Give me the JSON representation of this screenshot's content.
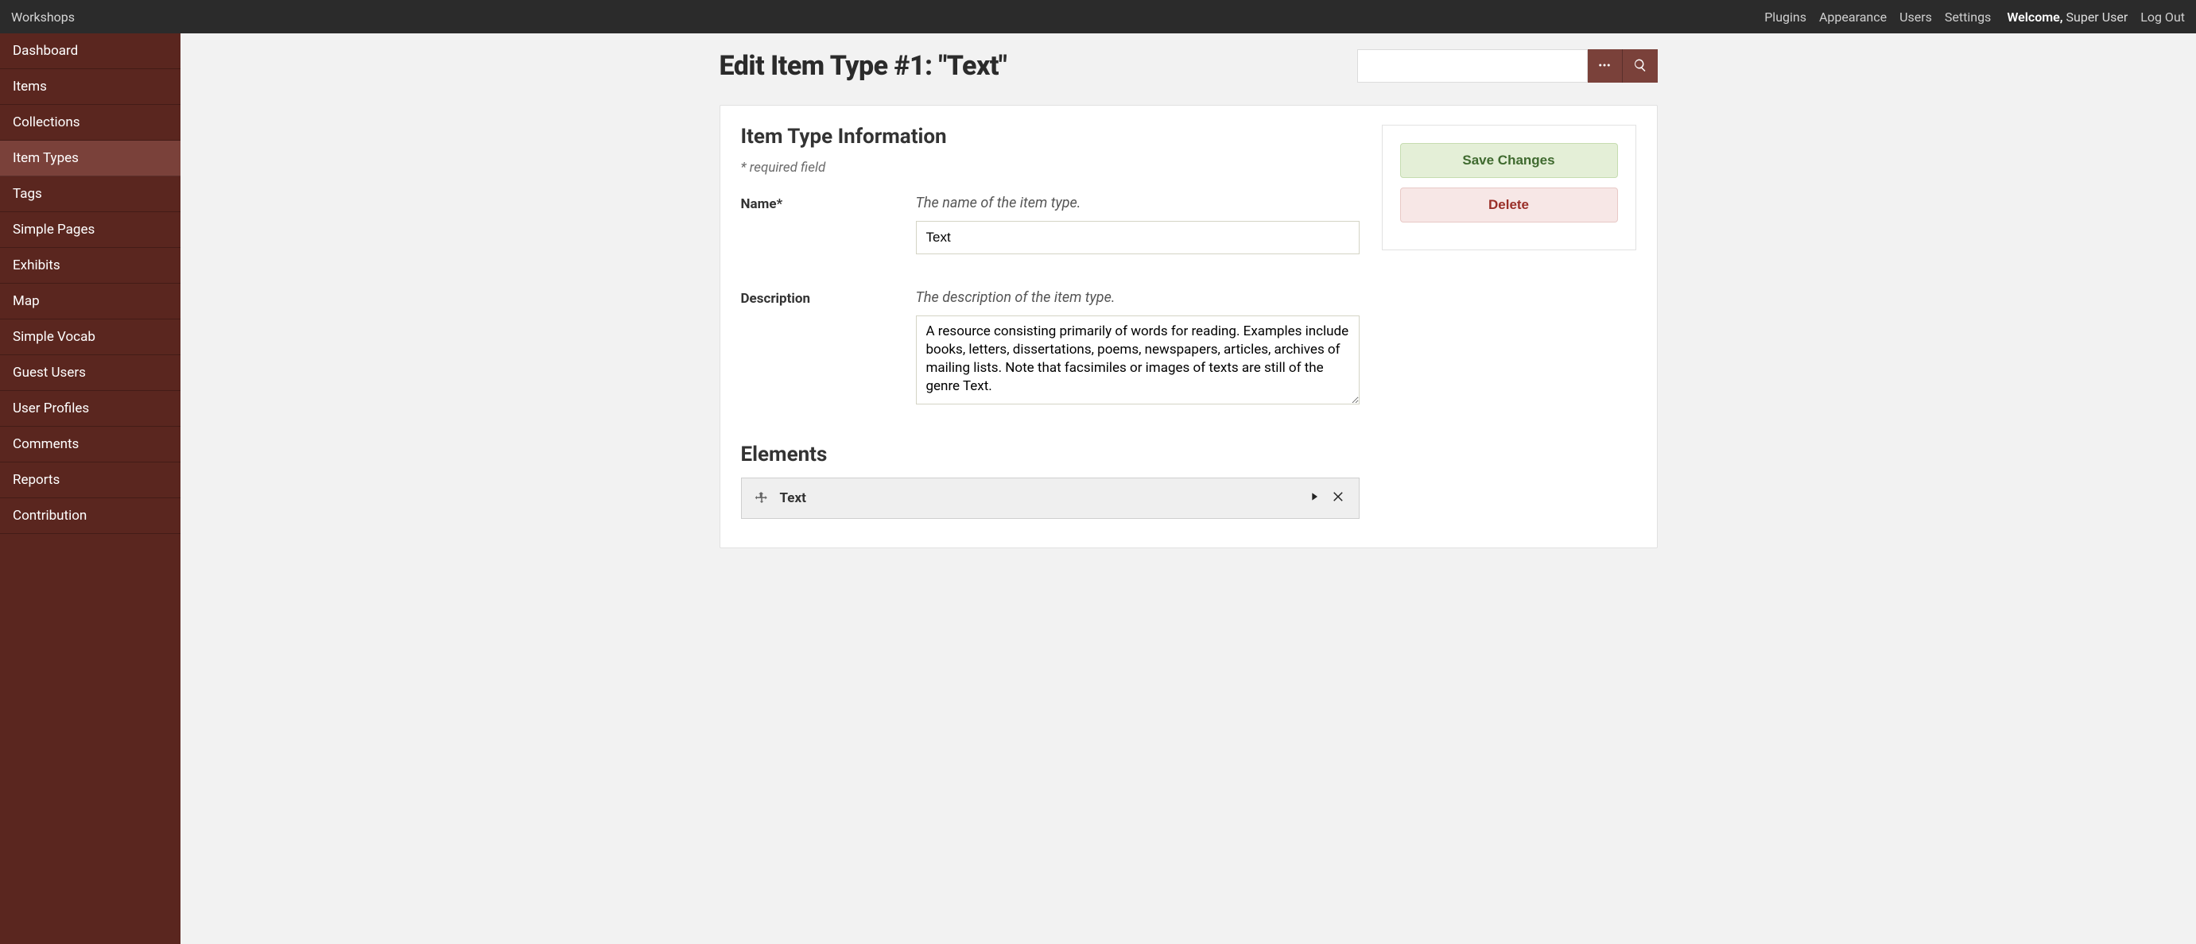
{
  "topbar": {
    "brand": "Workshops",
    "links": [
      "Plugins",
      "Appearance",
      "Users",
      "Settings"
    ],
    "welcome_label": "Welcome,",
    "user_name": "Super User",
    "logout": "Log Out"
  },
  "sidebar": {
    "items": [
      "Dashboard",
      "Items",
      "Collections",
      "Item Types",
      "Tags",
      "Simple Pages",
      "Exhibits",
      "Map",
      "Simple Vocab",
      "Guest Users",
      "User Profiles",
      "Comments",
      "Reports",
      "Contribution"
    ],
    "active_index": 3
  },
  "page": {
    "title": "Edit Item Type #1: \"Text\""
  },
  "search": {
    "placeholder": ""
  },
  "section": {
    "heading": "Item Type Information",
    "required_note": "* required field",
    "fields": {
      "name": {
        "label": "Name*",
        "hint": "The name of the item type.",
        "value": "Text"
      },
      "description": {
        "label": "Description",
        "hint": "The description of the item type.",
        "value": "A resource consisting primarily of words for reading. Examples include books, letters, dissertations, poems, newspapers, articles, archives of mailing lists. Note that facsimiles or images of texts are still of the genre Text."
      }
    },
    "elements_heading": "Elements",
    "elements": [
      {
        "name": "Text"
      }
    ]
  },
  "actions": {
    "save": "Save Changes",
    "delete": "Delete"
  }
}
